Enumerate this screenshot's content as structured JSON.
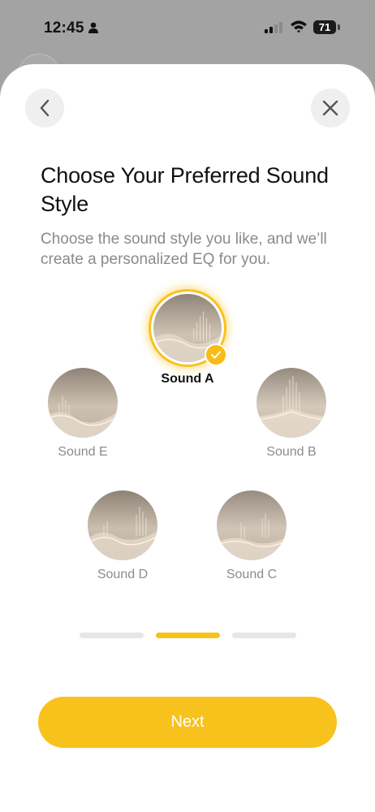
{
  "status_bar": {
    "time": "12:45",
    "battery": "71",
    "icons": [
      "person-icon",
      "signal-icon",
      "wifi-icon",
      "battery-icon"
    ]
  },
  "header": {
    "back_icon": "chevron-left-icon",
    "close_icon": "close-icon"
  },
  "content": {
    "title": "Choose Your Preferred Sound Style",
    "subtitle": "Choose the sound style you like, and we’ll create a personalized EQ for you."
  },
  "sounds": [
    {
      "label": "Sound A",
      "selected": true
    },
    {
      "label": "Sound E",
      "selected": false
    },
    {
      "label": "Sound B",
      "selected": false
    },
    {
      "label": "Sound D",
      "selected": false
    },
    {
      "label": "Sound C",
      "selected": false
    }
  ],
  "pager": {
    "total": 3,
    "current": 2
  },
  "actions": {
    "next_label": "Next"
  },
  "colors": {
    "accent": "#f8c21c",
    "secondary_text": "#8c8c8c",
    "button_bg": "#efefef"
  }
}
